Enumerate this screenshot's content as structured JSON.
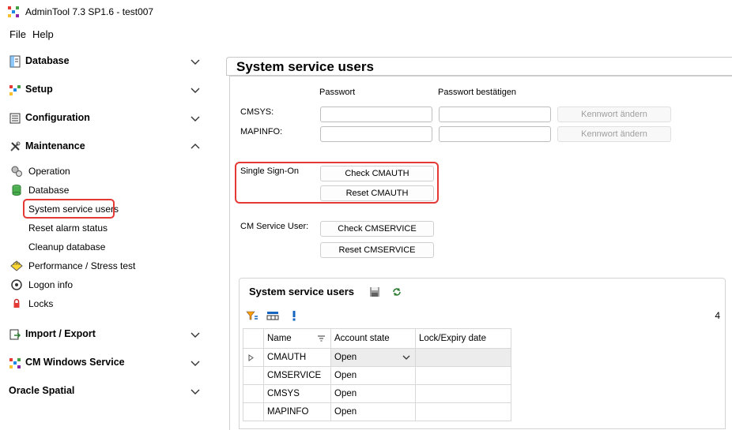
{
  "window": {
    "title": "AdminTool 7.3 SP1.6 - test007"
  },
  "menu": {
    "file": "File",
    "help": "Help"
  },
  "sidebar": {
    "sections": {
      "database": "Database",
      "setup": "Setup",
      "configuration": "Configuration",
      "maintenance": "Maintenance",
      "import_export": "Import / Export",
      "cm_windows_service": "CM Windows Service",
      "oracle_spatial": "Oracle Spatial"
    },
    "maintenance_items": {
      "operation": "Operation",
      "database": "Database",
      "system_service_users": "System service users",
      "reset_alarm_status": "Reset alarm status",
      "cleanup_database": "Cleanup database",
      "performance": "Performance / Stress test",
      "logon_info": "Logon info",
      "locks": "Locks"
    }
  },
  "main": {
    "title": "System service users",
    "col_password": "Passwort",
    "col_confirm": "Passwort bestätigen",
    "cmsys_label": "CMSYS:",
    "mapinfo_label": "MAPINFO:",
    "change_pw_label": "Kennwort ändern",
    "sso_label": "Single Sign-On",
    "check_cmauth": "Check CMAUTH",
    "reset_cmauth": "Reset CMAUTH",
    "cm_service_user_label": "CM Service User:",
    "check_cmservice": "Check CMSERVICE",
    "reset_cmservice": "Reset CMSERVICE"
  },
  "grid": {
    "title": "System service users",
    "count": "4",
    "columns": [
      "Name",
      "Account state",
      "Lock/Expiry date"
    ],
    "rows": [
      {
        "name": "CMAUTH",
        "state": "Open",
        "date": ""
      },
      {
        "name": "CMSERVICE",
        "state": "Open",
        "date": ""
      },
      {
        "name": "CMSYS",
        "state": "Open",
        "date": ""
      },
      {
        "name": "MAPINFO",
        "state": "Open",
        "date": ""
      }
    ]
  },
  "colors": {
    "highlight": "#e53935",
    "selected_row": "#ececec"
  }
}
